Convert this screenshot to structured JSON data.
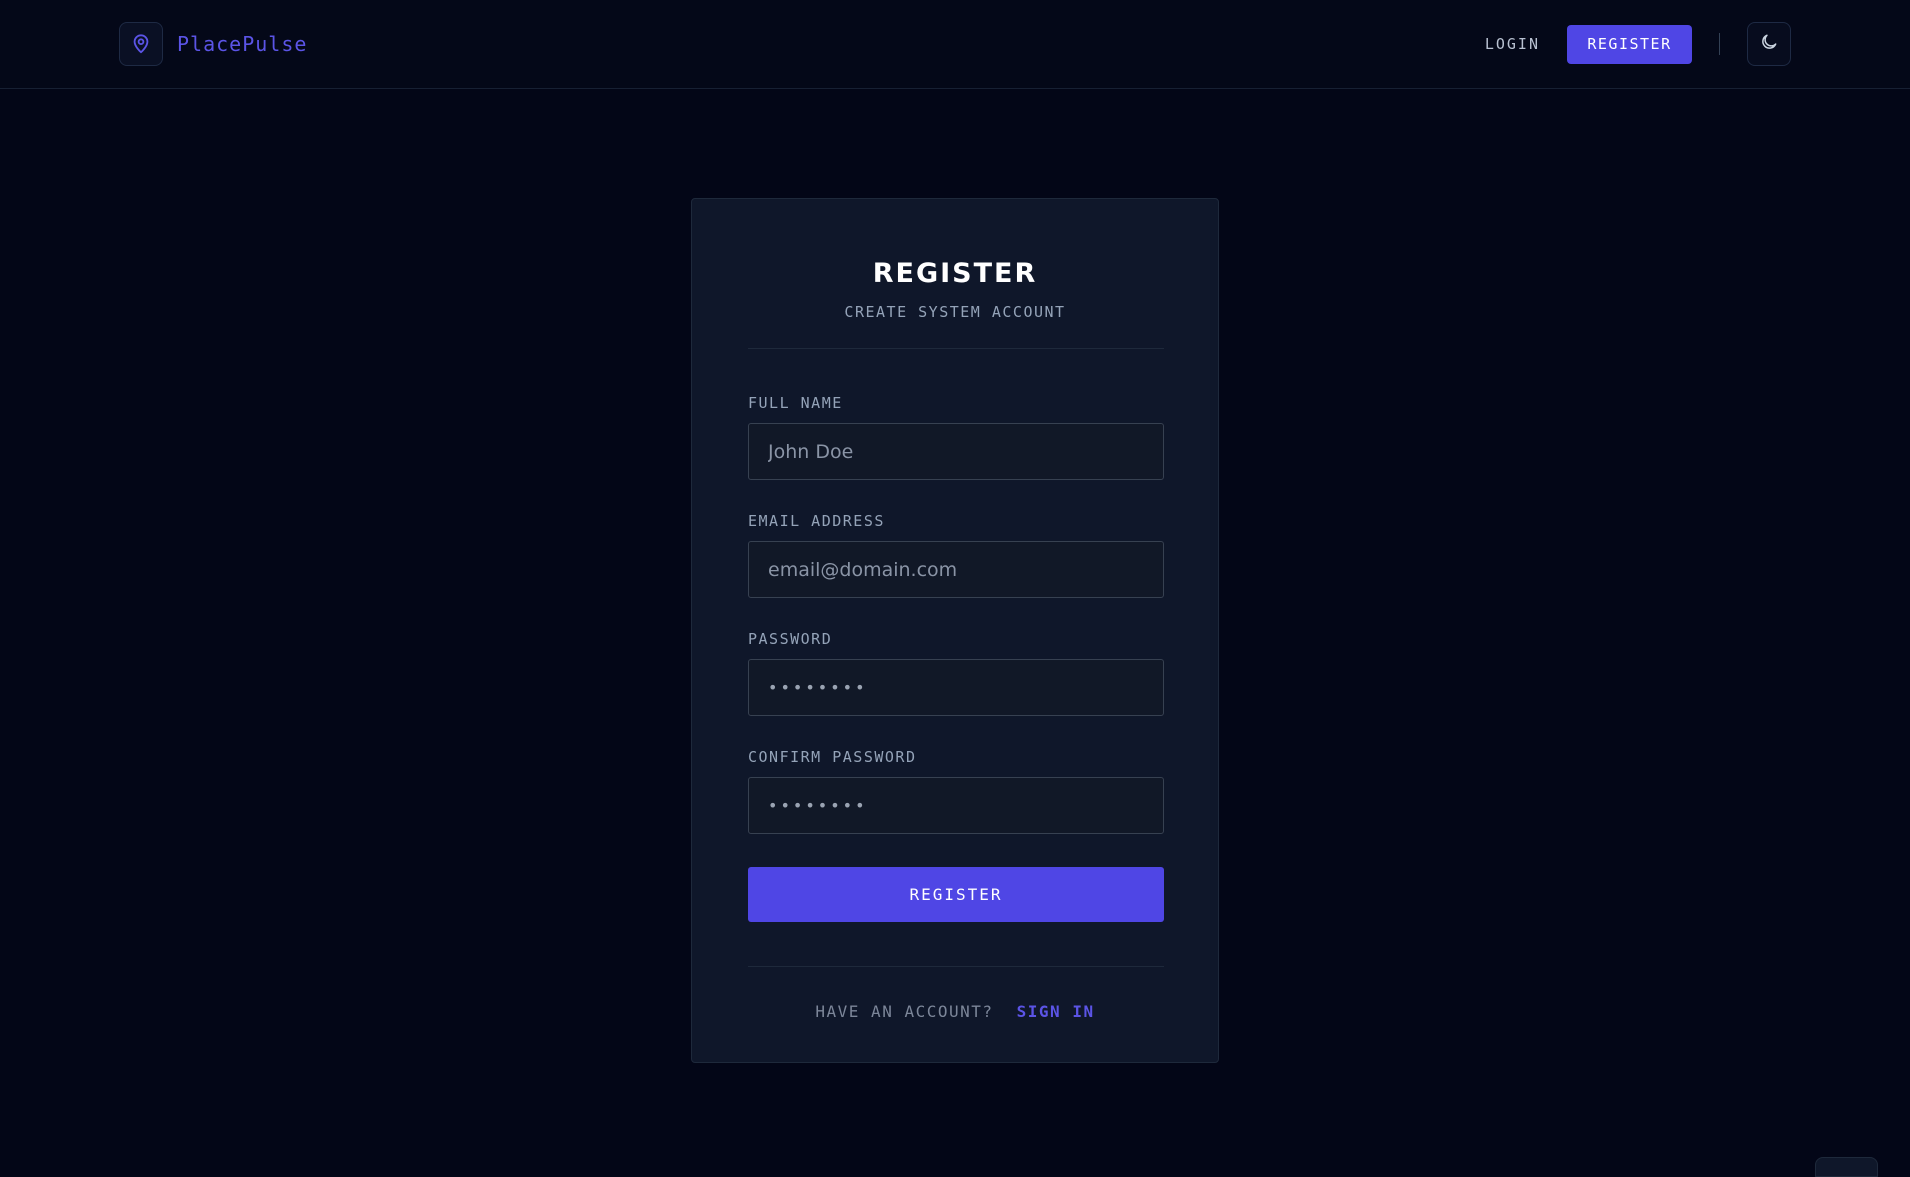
{
  "header": {
    "brand_name": "PlacePulse",
    "brand_icon": "map-pin-icon",
    "login_label": "LOGIN",
    "register_label": "REGISTER",
    "theme_icon": "moon-icon"
  },
  "card": {
    "title": "REGISTER",
    "subtitle": "CREATE SYSTEM ACCOUNT",
    "fields": [
      {
        "label": "FULL NAME",
        "placeholder": "John Doe"
      },
      {
        "label": "EMAIL ADDRESS",
        "placeholder": "email@domain.com"
      },
      {
        "label": "PASSWORD",
        "placeholder": "••••••••"
      },
      {
        "label": "CONFIRM PASSWORD",
        "placeholder": "••••••••"
      }
    ],
    "submit_label": "REGISTER",
    "footer_text": "HAVE AN ACCOUNT?",
    "footer_link": "SIGN IN"
  },
  "colors": {
    "background": "#030617",
    "card": "#0f172a",
    "accent": "#4f46e5",
    "brand_text": "#5b54e6"
  }
}
